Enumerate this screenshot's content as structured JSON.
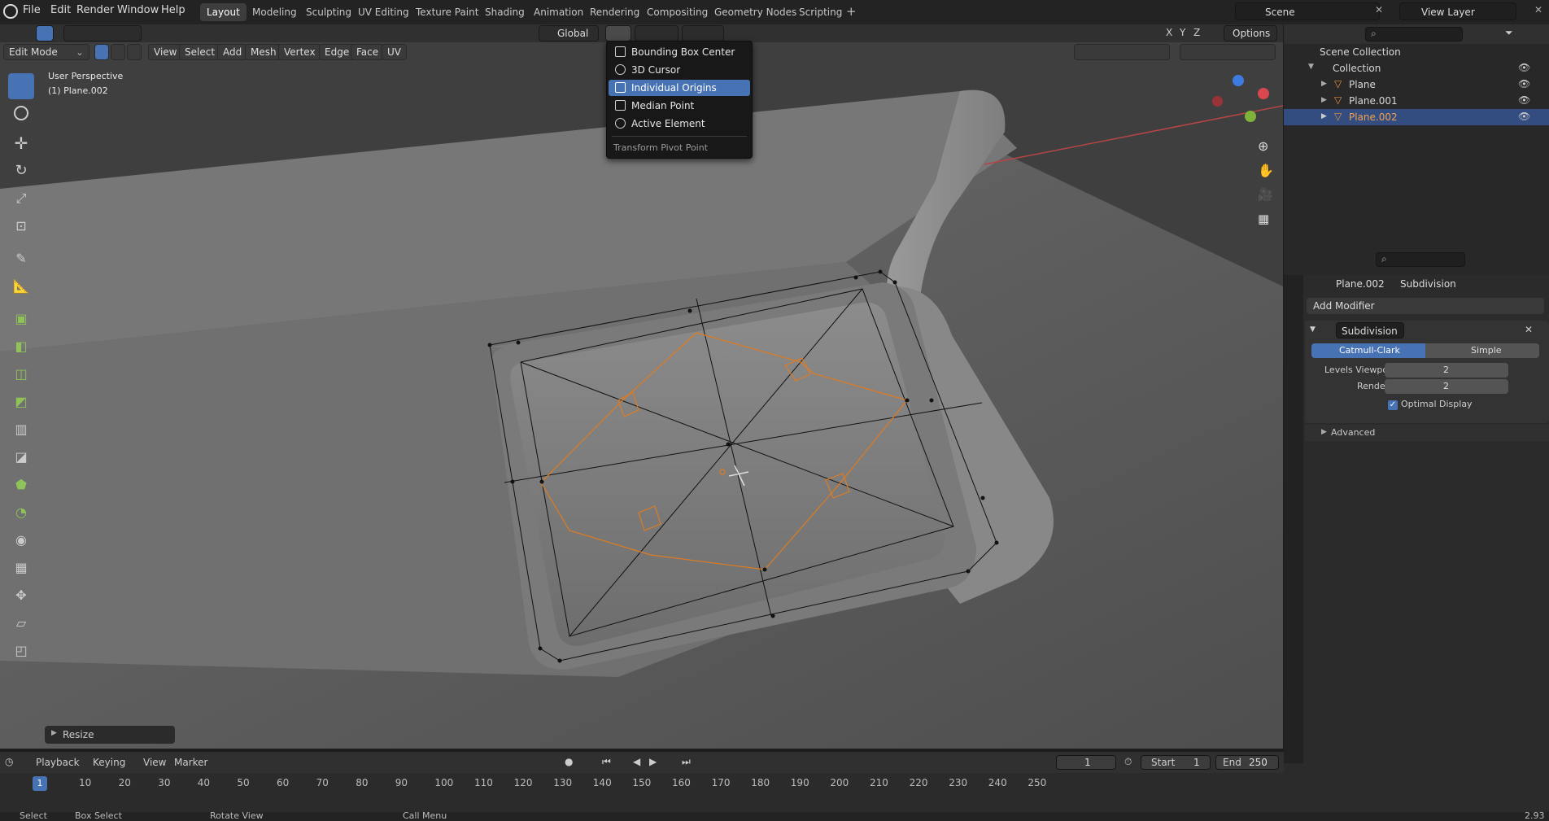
{
  "top_menu": [
    "File",
    "Edit",
    "Render",
    "Window",
    "Help"
  ],
  "workspaces": [
    "Layout",
    "Modeling",
    "Sculpting",
    "UV Editing",
    "Texture Paint",
    "Shading",
    "Animation",
    "Rendering",
    "Compositing",
    "Geometry Nodes",
    "Scripting"
  ],
  "active_workspace": "Layout",
  "scene_name": "Scene",
  "view_layer": "View Layer",
  "header": {
    "orientation": "Global",
    "options": "Options",
    "axes": [
      "X",
      "Y",
      "Z"
    ]
  },
  "viewport_header": {
    "mode": "Edit Mode",
    "menus": [
      "View",
      "Select",
      "Add",
      "Mesh",
      "Vertex",
      "Edge",
      "Face",
      "UV"
    ]
  },
  "viewport_info": {
    "line1": "User Perspective",
    "line2": "(1) Plane.002"
  },
  "operator_panel": "Resize",
  "pivot_dropdown": {
    "items": [
      "Bounding Box Center",
      "3D Cursor",
      "Individual Origins",
      "Median Point",
      "Active Element"
    ],
    "highlighted": "Individual Origins",
    "title": "Transform Pivot Point"
  },
  "outliner": {
    "root": "Scene Collection",
    "collection": "Collection",
    "objects": [
      "Plane",
      "Plane.001",
      "Plane.002"
    ],
    "selected": "Plane.002"
  },
  "properties": {
    "object": "Plane.002",
    "modifier_context": "Subdivision",
    "add_modifier": "Add Modifier",
    "modifier_name": "Subdivision",
    "modes": [
      "Catmull-Clark",
      "Simple"
    ],
    "levels_viewport_label": "Levels Viewport",
    "levels_viewport": "2",
    "render_label": "Render",
    "render": "2",
    "optimal_display": "Optimal Display",
    "advanced": "Advanced"
  },
  "timeline": {
    "menus": [
      "Playback",
      "Keying",
      "View",
      "Marker"
    ],
    "current_frame": "1",
    "start_label": "Start",
    "start": "1",
    "end_label": "End",
    "end": "250",
    "ticks": [
      "10",
      "20",
      "30",
      "40",
      "50",
      "60",
      "70",
      "80",
      "90",
      "100",
      "110",
      "120",
      "130",
      "140",
      "150",
      "160",
      "170",
      "180",
      "190",
      "200",
      "210",
      "220",
      "230",
      "240",
      "250"
    ]
  },
  "statusbar": {
    "select": "Select",
    "box_select": "Box Select",
    "rotate_view": "Rotate View",
    "call_menu": "Call Menu",
    "version": "2.93"
  }
}
